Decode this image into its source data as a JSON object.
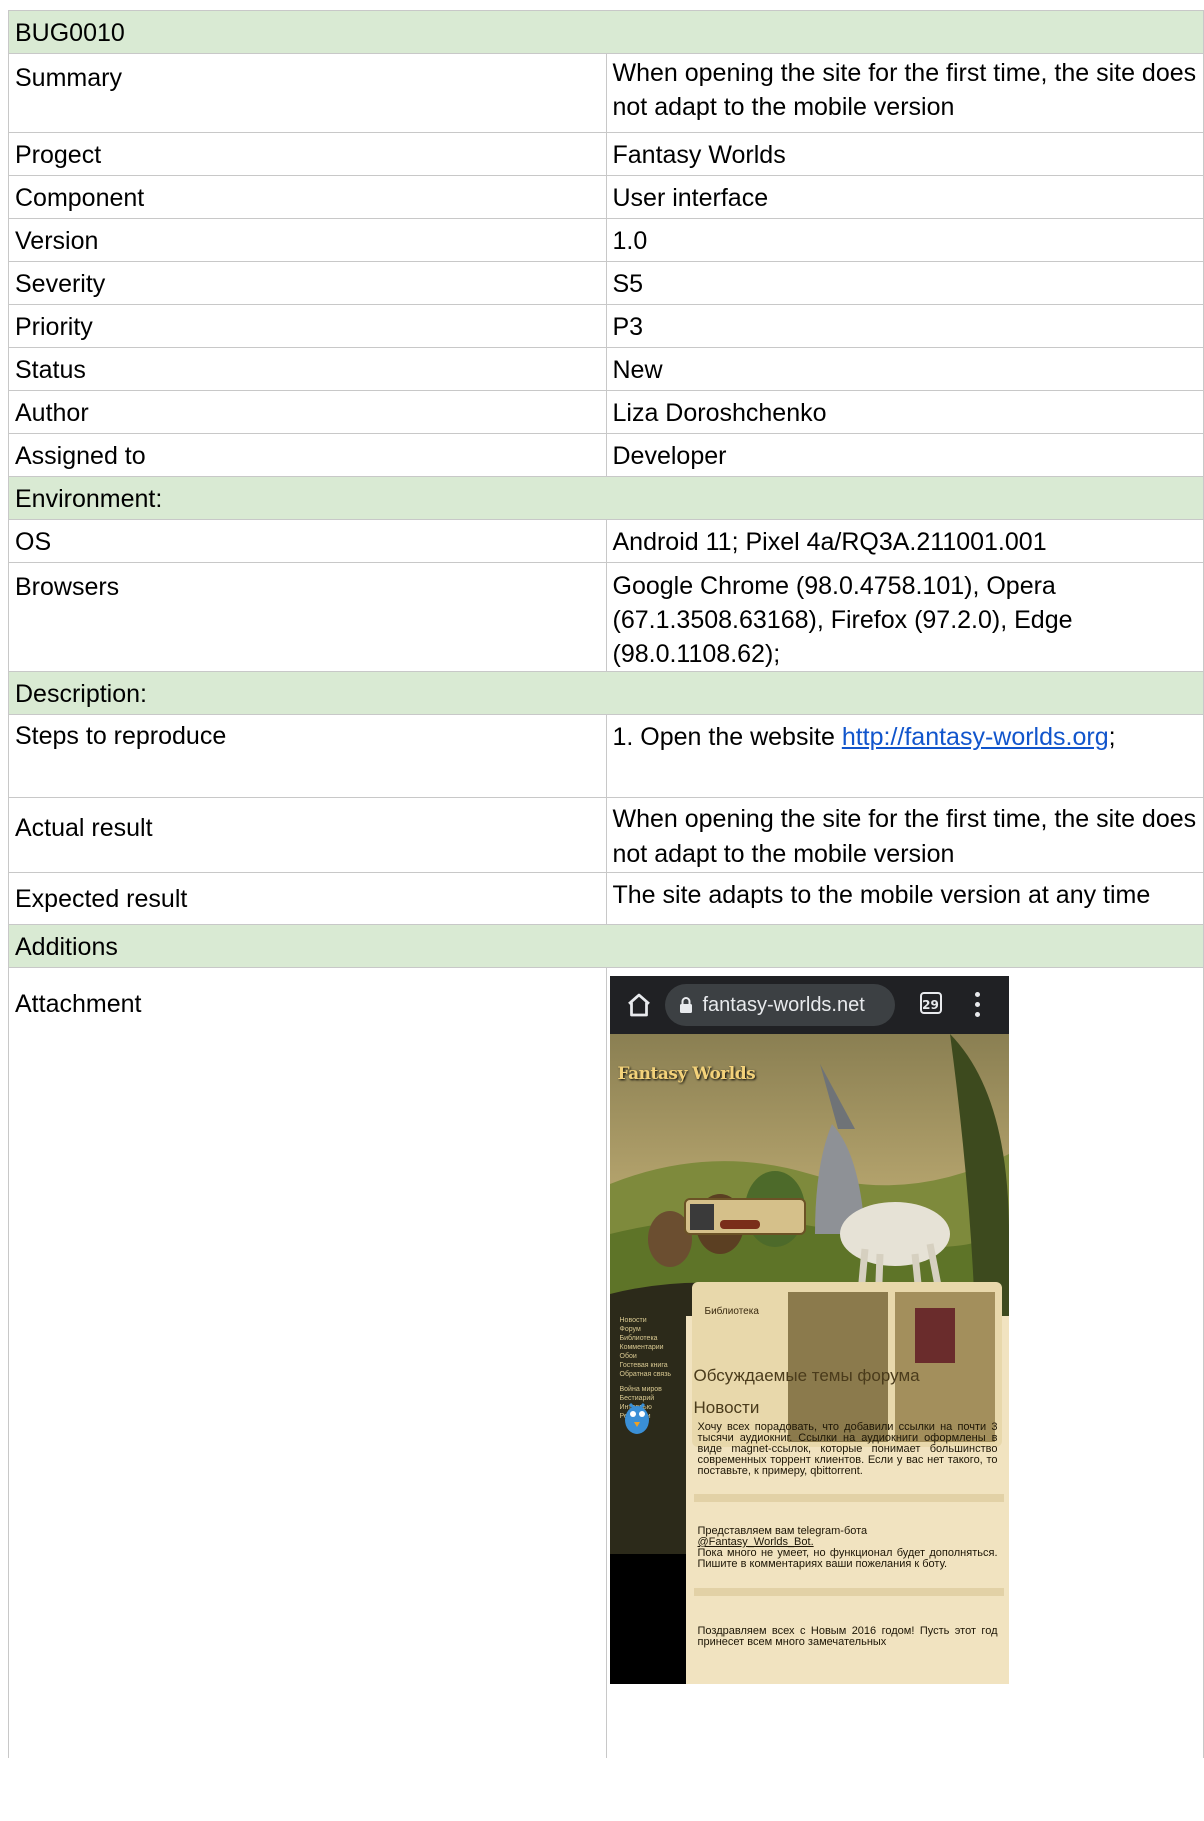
{
  "title": "BUG0010",
  "fields": [
    {
      "label": "Summary",
      "value": "When opening the site for the first time, the site does not adapt to the mobile version"
    },
    {
      "label": "Progect",
      "value": "Fantasy Worlds"
    },
    {
      "label": "Component",
      "value": "User interface"
    },
    {
      "label": "Version",
      "value": "1.0"
    },
    {
      "label": "Severity",
      "value": "S5"
    },
    {
      "label": "Priority",
      "value": "P3"
    },
    {
      "label": "Status",
      "value": "New"
    },
    {
      "label": "Author",
      "value": "Liza Doroshchenko"
    },
    {
      "label": "Assigned to",
      "value": "Developer"
    }
  ],
  "environment": {
    "header": "Environment:",
    "os_label": "OS",
    "os_value": "Android 11; Pixel 4a/RQ3A.211001.001",
    "browsers_label": "Browsers",
    "browsers_value": "Google Chrome (98.0.4758.101), Opera (67.1.3508.63168), Firefox (97.2.0), Edge (98.0.1108.62);"
  },
  "description": {
    "header": "Description:",
    "steps_label": "Steps to reproduce",
    "steps_prefix": "1. Open the website  ",
    "steps_link": "http://fantasy-worlds.org",
    "steps_suffix": ";",
    "actual_label": "Actual result",
    "actual_value": "When opening the site for the first time, the site does not adapt to the mobile version",
    "expected_label": "Expected result",
    "expected_value": "The site adapts to the mobile version at any time"
  },
  "additions": {
    "header": "Additions",
    "attachment_label": "Attachment"
  },
  "screenshot": {
    "url": "fantasy-worlds.net",
    "tab_count": "29",
    "logo": "Fantasy Worlds",
    "library_title": "Библиотека",
    "forum_title": "Обсуждаемые темы форума",
    "news_title": "Новости",
    "news_1": "Хочу всех порадовать, что добавили ссылки на почти 3 тысячи аудиокниг. Ссылки на аудиокниги оформлены в виде magnet-ссылок, которые понимает большинство современных торрент клиентов. Если у вас нет такого, то поставьте, к примеру, qbittorrent.",
    "news_2a": "Представляем вам telegram-бота",
    "news_2b": "@Fantasy_Worlds_Bot.",
    "news_2c": "Пока много не умеет, но функционал будет дополняться. Пишите в комментариях ваши пожелания к боту.",
    "news_3": "Поздравляем всех с Новым 2016 годом! Пусть этот год принесет всем много замечательных",
    "sidebar_items": [
      "Новости",
      "Форум",
      "Библиотека",
      "Комментарии",
      "Обои",
      "Гостевая книга",
      "Обратная связь",
      "Война миров",
      "Бестиарий",
      "Интервью",
      "Рецензии"
    ]
  }
}
